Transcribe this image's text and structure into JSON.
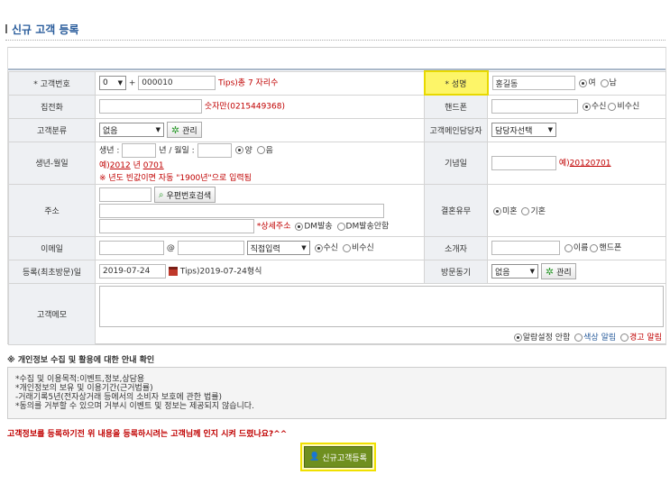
{
  "page": {
    "title": "신규 고객 등록"
  },
  "form": {
    "customer_no": {
      "label": "* 고객번호",
      "prefix": "0",
      "plus": "+",
      "value": "000010",
      "tip": "Tips)총 7 자리수"
    },
    "name": {
      "label": "* 성명",
      "value": "홍길동",
      "gender": [
        "여",
        "남"
      ]
    },
    "home_phone": {
      "label": "집전화",
      "hint": "숫자만(0215449368)"
    },
    "mobile": {
      "label": "핸드폰",
      "options": [
        "수신",
        "비수신"
      ]
    },
    "category": {
      "label": "고객분류",
      "value": "없음",
      "manage": "관리"
    },
    "manager": {
      "label": "고객메인담당자",
      "value": "담당자선택"
    },
    "birth": {
      "label": "생년-월일",
      "year_label": "생년 :",
      "md_label": "년 / 월일 :",
      "cal": [
        "양",
        "음"
      ],
      "ex_prefix": "예)",
      "ex_year": "2012",
      "ex_mid": " 년 ",
      "ex_md": "0701",
      "note": "※ 년도 빈값이면 자동 \"1900년\"으로 입력됨"
    },
    "anniv": {
      "label": "기념일",
      "ex_prefix": "예)",
      "ex": "20120701"
    },
    "address": {
      "label": "주소",
      "search": "우편번호검색",
      "detail_note": "*상세주소",
      "dm": [
        "DM발송",
        "DM발송안함"
      ]
    },
    "marriage": {
      "label": "결혼유무",
      "options": [
        "미혼",
        "기혼"
      ]
    },
    "email": {
      "label": "이메일",
      "at": "@",
      "domain": "직접입력",
      "options": [
        "수신",
        "비수신"
      ]
    },
    "referrer": {
      "label": "소개자",
      "options": [
        "이름",
        "핸드폰"
      ]
    },
    "reg_date": {
      "label": "등록(최초방문)일",
      "value": "2019-07-24",
      "tip": "Tips)2019-07-24형식"
    },
    "visit": {
      "label": "방문동기",
      "value": "없음",
      "manage": "관리"
    },
    "memo": {
      "label": "고객메모",
      "alarm": [
        "알람설정 안함",
        "색상 알림",
        "경고 알림"
      ]
    }
  },
  "privacy": {
    "title": "※ 개인정보 수집 및 활용에 대한 안내 확인",
    "lines": [
      "*수집 및 이용목적:이벤트,정보,상담용",
      "*개인정보의 보유 및 이용기간(근거법률)",
      "-거래기록5년(전자상거래 등에서의 소비자 보호에 관한 법률)",
      "*동의를 거부할 수 있으며 거부시 이벤트 및 정보는 제공되지 않습니다."
    ]
  },
  "confirm_text": "고객정보를 등록하기전 위 내용을 등록하시려는 고객님께 인지 시켜 드렸나요?^^",
  "submit_label": "신규고객등록",
  "colors": {
    "title": "#2a5d9c",
    "highlight": "#fdf568",
    "red": "#c00000",
    "button": "#6f8f1f",
    "label_bg": "#eef0f3"
  }
}
